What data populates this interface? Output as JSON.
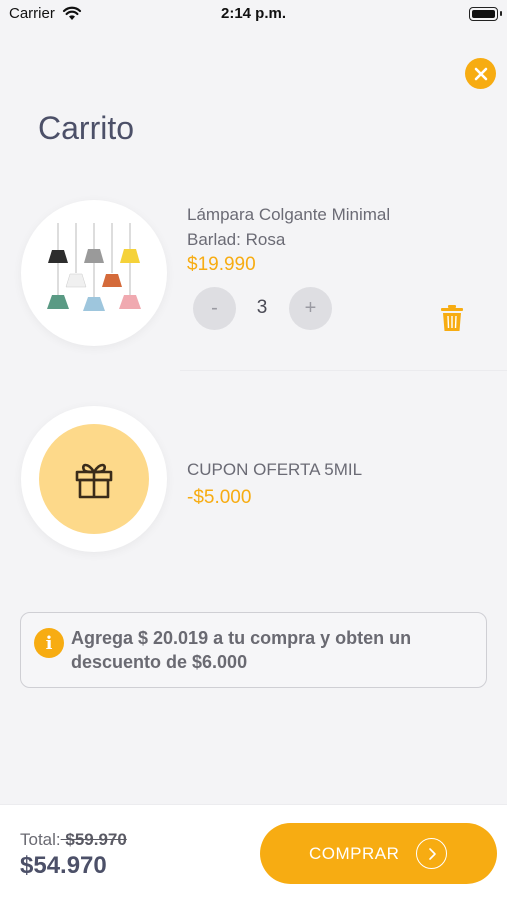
{
  "status_bar": {
    "carrier": "Carrier",
    "time": "2:14 p.m."
  },
  "header": {
    "title": "Carrito"
  },
  "cart": {
    "product": {
      "name": "Lámpara Colgante Minimal Barlad: Rosa",
      "price": "$19.990",
      "quantity": "3",
      "decrement_label": "-",
      "increment_label": "+"
    },
    "coupon": {
      "name": "CUPON OFERTA 5MIL",
      "value": "-$5.000"
    }
  },
  "info": {
    "icon_label": "i",
    "message": "Agrega $ 20.019 a tu compra y obten un descuento de $6.000"
  },
  "footer": {
    "total_label": "Total:",
    "total_old": " $59.970",
    "total_new": "$54.970",
    "buy_label": "COMPRAR"
  },
  "colors": {
    "accent": "#f7ac12",
    "gift_bg": "#fdd98a",
    "title": "#4c5068",
    "background": "#f4f4f6"
  },
  "icons": [
    "wifi-icon",
    "battery-icon",
    "close-icon",
    "trash-icon",
    "gift-icon",
    "info-icon",
    "chevron-right-icon"
  ]
}
